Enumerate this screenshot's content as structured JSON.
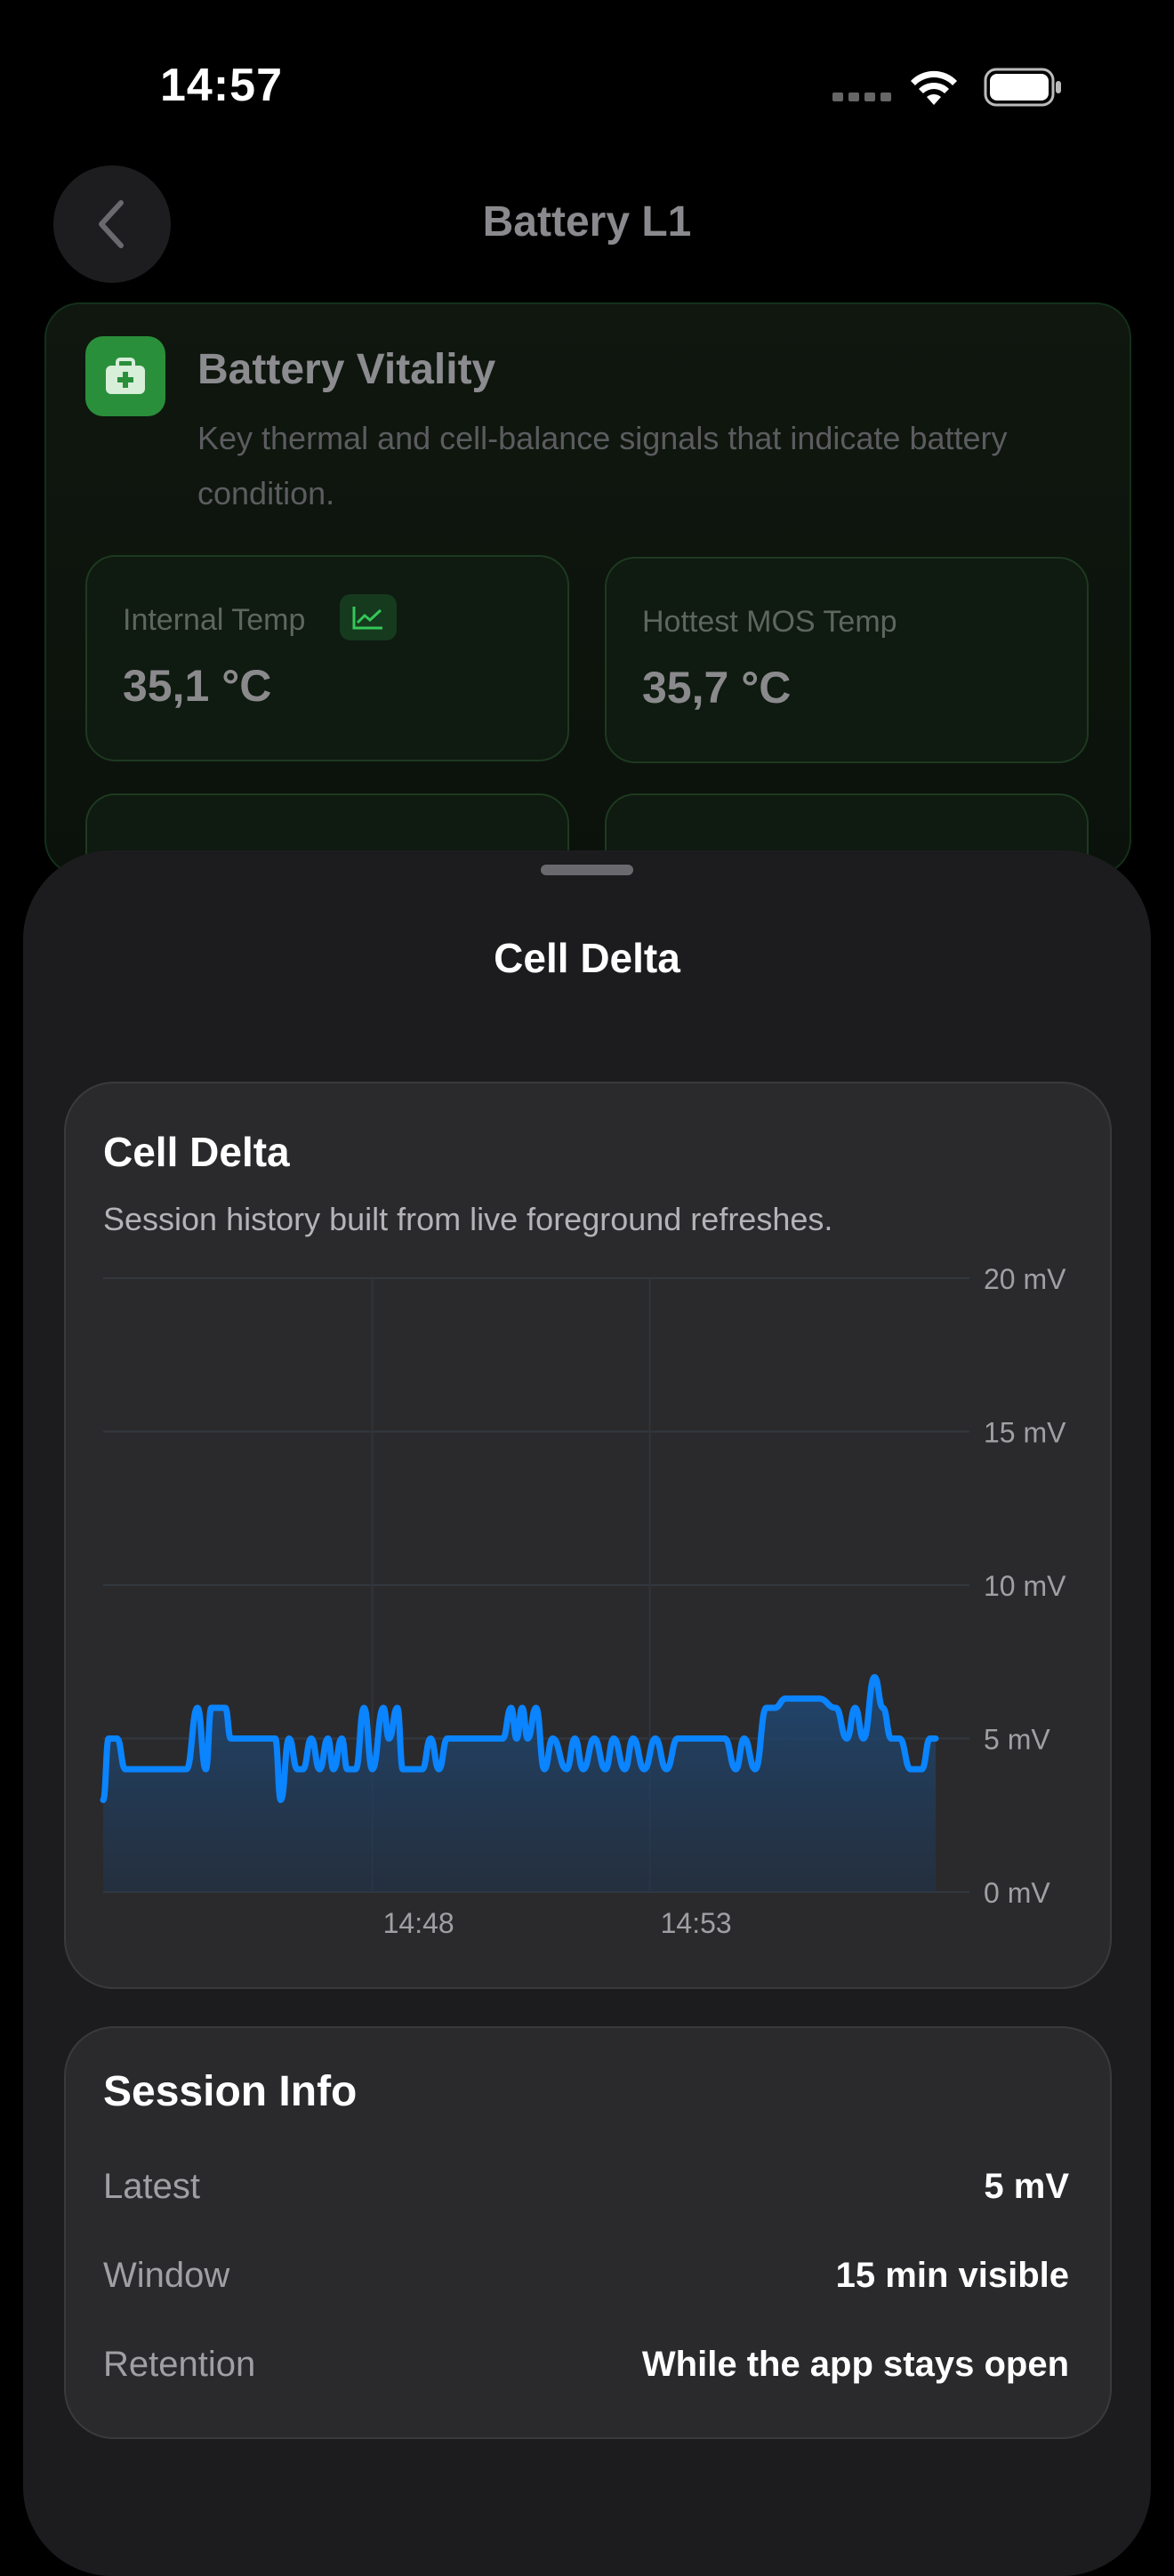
{
  "status_bar": {
    "time": "14:57"
  },
  "nav": {
    "title": "Battery L1",
    "back_icon": "chevron-left-icon"
  },
  "vitality": {
    "title": "Battery Vitality",
    "subtitle": "Key thermal and cell-balance signals that indicate battery condition.",
    "icon": "first-aid-kit-icon",
    "metrics": [
      {
        "label": "Internal Temp",
        "value": "35,1 °C",
        "has_chart_icon": true
      },
      {
        "label": "Hottest MOS Temp",
        "value": "35,7 °C",
        "has_chart_icon": false
      }
    ]
  },
  "sheet": {
    "title": "Cell Delta"
  },
  "chart_card": {
    "title": "Cell Delta",
    "subtitle": "Session history built from live foreground refreshes."
  },
  "chart_data": {
    "type": "area",
    "title": "Cell Delta",
    "ylim": [
      0,
      20
    ],
    "yticks": [
      {
        "value": 20,
        "label": "20 mV"
      },
      {
        "value": 15,
        "label": "15 mV"
      },
      {
        "value": 10,
        "label": "10 mV"
      },
      {
        "value": 5,
        "label": "5 mV"
      },
      {
        "value": 0,
        "label": "0 mV"
      }
    ],
    "xlim": [
      0,
      15
    ],
    "xticks": [
      {
        "value": 4.85,
        "label": "14:48"
      },
      {
        "value": 9.85,
        "label": "14:53"
      }
    ],
    "grid": true,
    "line_color": "#0a84ff",
    "series": [
      {
        "x": [
          0.0,
          0.1,
          0.25,
          0.4,
          0.5,
          0.6,
          0.8,
          1.0,
          1.2,
          1.5,
          1.7,
          1.85,
          1.95,
          2.05,
          2.2,
          2.3,
          2.5,
          2.6,
          2.75,
          2.9,
          3.1,
          3.2,
          3.35,
          3.5,
          3.6,
          3.75,
          3.9,
          4.05,
          4.15,
          4.3,
          4.4,
          4.55,
          4.7,
          4.85,
          5.05,
          5.15,
          5.3,
          5.4,
          5.6,
          5.75,
          5.9,
          6.05,
          6.2,
          6.4,
          6.6,
          6.9,
          7.2,
          7.35,
          7.45,
          7.55,
          7.65,
          7.8,
          7.95,
          8.1,
          8.35,
          8.5,
          8.65,
          8.85,
          9.05,
          9.2,
          9.4,
          9.55,
          9.75,
          9.95,
          10.15,
          10.35,
          10.55,
          10.75,
          11.0,
          11.2,
          11.4,
          11.55,
          11.75,
          11.95,
          12.1,
          12.3,
          12.6,
          12.9,
          13.2,
          13.4,
          13.55,
          13.7,
          13.9,
          14.05,
          14.2,
          14.35,
          14.55,
          14.75,
          14.9,
          15.0
        ],
        "y": [
          3.0,
          5.0,
          5.0,
          4.0,
          4.0,
          4.0,
          4.0,
          4.0,
          4.0,
          4.0,
          6.0,
          4.0,
          6.0,
          6.0,
          6.0,
          5.0,
          5.0,
          5.0,
          5.0,
          5.0,
          5.0,
          3.0,
          5.0,
          4.0,
          4.0,
          5.0,
          4.0,
          5.0,
          4.0,
          5.0,
          4.0,
          4.0,
          6.0,
          4.0,
          6.0,
          5.0,
          6.0,
          4.0,
          4.0,
          4.0,
          5.0,
          4.0,
          5.0,
          5.0,
          5.0,
          5.0,
          5.0,
          6.0,
          5.0,
          6.0,
          5.0,
          6.0,
          4.0,
          5.0,
          4.0,
          5.0,
          4.0,
          5.0,
          4.0,
          5.0,
          4.0,
          5.0,
          4.0,
          5.0,
          4.0,
          5.0,
          5.0,
          5.0,
          5.0,
          5.0,
          4.0,
          5.0,
          4.0,
          6.0,
          6.0,
          6.3,
          6.3,
          6.3,
          6.0,
          5.0,
          6.0,
          5.0,
          7.0,
          6.0,
          5.0,
          5.0,
          4.0,
          4.0,
          5.0,
          5.0
        ]
      }
    ]
  },
  "session_info": {
    "title": "Session Info",
    "rows": [
      {
        "label": "Latest",
        "value": "5 mV"
      },
      {
        "label": "Window",
        "value": "15 min visible"
      },
      {
        "label": "Retention",
        "value": "While the app stays open"
      }
    ]
  }
}
